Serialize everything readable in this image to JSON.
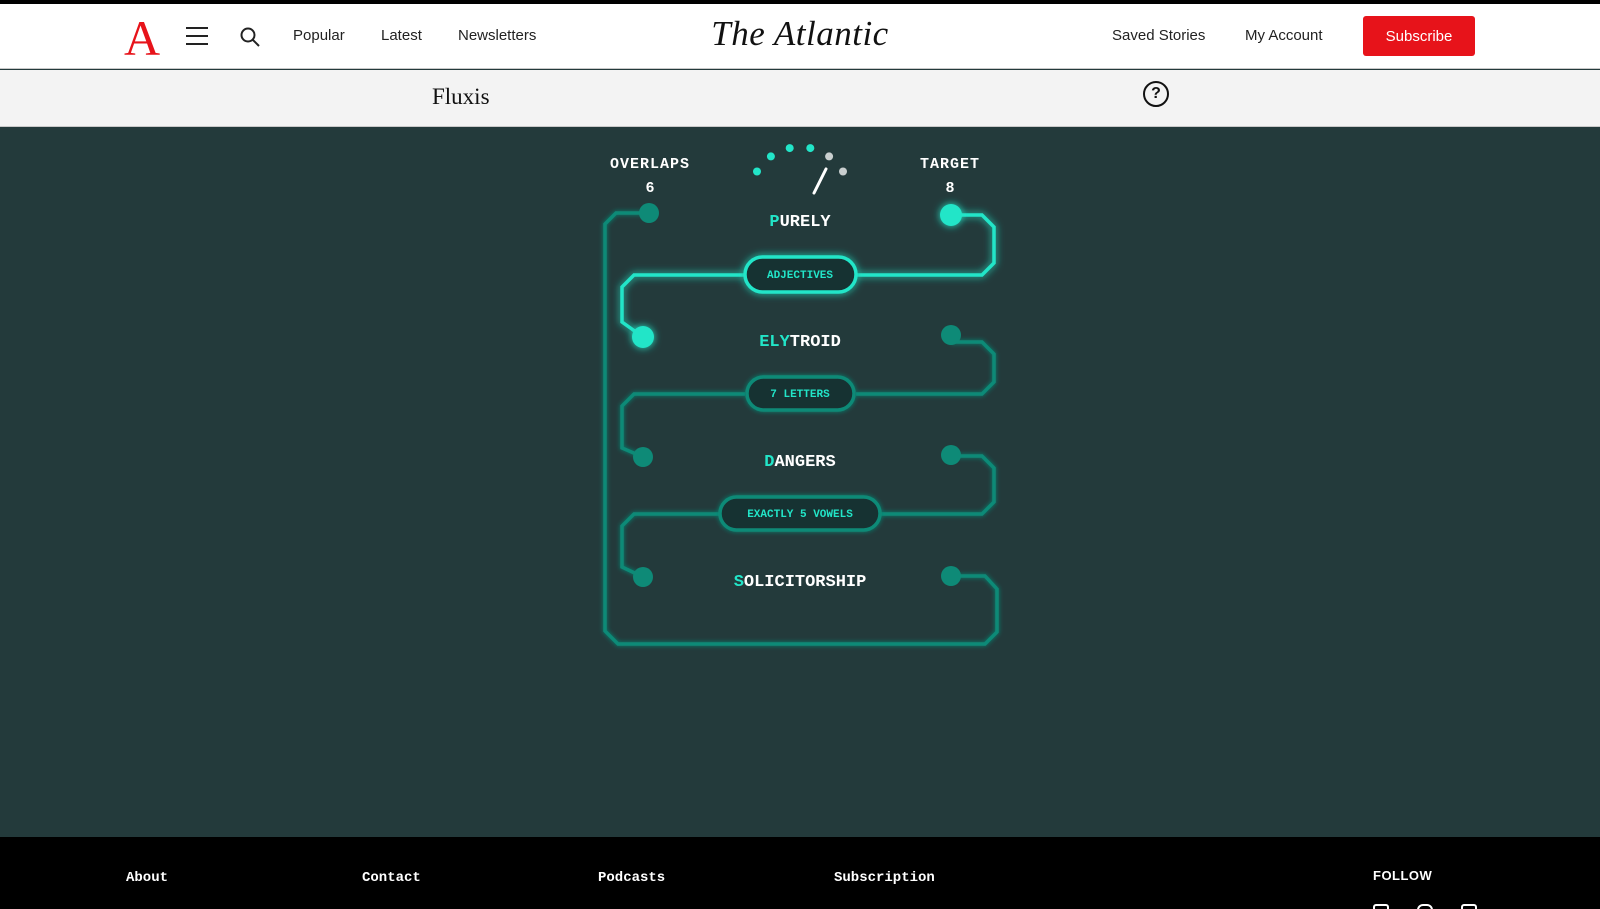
{
  "header": {
    "logo": "A",
    "brand": "The Atlantic",
    "nav": [
      "Popular",
      "Latest",
      "Newsletters"
    ],
    "right_links": [
      "Saved Stories",
      "My Account"
    ],
    "subscribe_label": "Subscribe"
  },
  "subheader": {
    "title": "Fluxis",
    "help": "?"
  },
  "game": {
    "overlaps_label": "OVERLAPS",
    "overlaps_value": "6",
    "target_label": "TARGET",
    "target_value": "8",
    "gauge": {
      "filled_dots": 4,
      "total_dots": 6
    },
    "words": [
      {
        "highlight": "P",
        "rest": "URELY"
      },
      {
        "highlight": "ELY",
        "rest": "TROID"
      },
      {
        "highlight": "D",
        "rest": "ANGERS"
      },
      {
        "highlight": "S",
        "rest": "OLICITORSHIP"
      }
    ],
    "clues": [
      "ADJECTIVES",
      "7 LETTERS",
      "EXACTLY 5 VOWELS"
    ],
    "colors": {
      "background": "#233a3b",
      "accent": "#22e5c8",
      "dim_accent": "#0e8a77"
    }
  },
  "footer": {
    "columns": [
      "About",
      "Contact",
      "Podcasts",
      "Subscription"
    ],
    "follow_label": "FOLLOW",
    "social_icons": [
      "facebook-icon",
      "instagram-icon",
      "youtube-icon"
    ]
  }
}
